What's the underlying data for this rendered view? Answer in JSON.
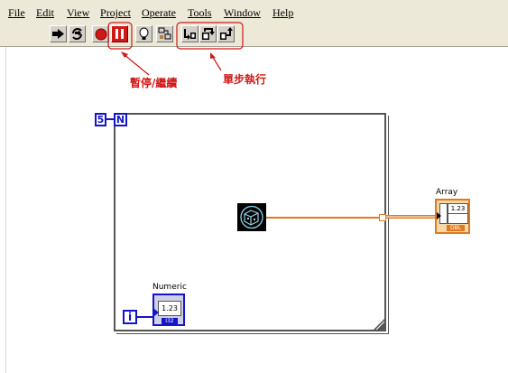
{
  "menubar": {
    "items": [
      "File",
      "Edit",
      "View",
      "Project",
      "Operate",
      "Tools",
      "Window",
      "Help"
    ]
  },
  "toolbar": {
    "buttons": [
      "run-icon",
      "run-continuously-icon",
      "abort-icon",
      "pause-icon",
      "highlight-execution-icon",
      "retain-wire-values-icon",
      "step-into-icon",
      "step-over-icon",
      "step-out-icon"
    ]
  },
  "annotations": {
    "pause_label": "暫停/繼續",
    "step_label": "單步執行"
  },
  "diagram": {
    "loop_count": "5",
    "loop_count_terminal": "N",
    "iteration_terminal": "i",
    "numeric_label": "Numeric",
    "numeric_value": "1.23",
    "numeric_type": "I32",
    "array_label": "Array",
    "array_value": "1.23",
    "array_type": "DBL"
  },
  "colors": {
    "callout": "#d01818",
    "wire_orange": "#e07a1f",
    "terminal_blue": "#1414c8"
  }
}
